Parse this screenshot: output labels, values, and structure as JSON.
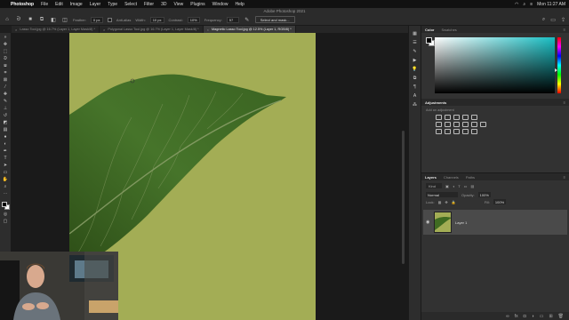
{
  "menubar": {
    "apple": "",
    "app_name": "Photoshop",
    "items": [
      "File",
      "Edit",
      "Image",
      "Layer",
      "Type",
      "Select",
      "Filter",
      "3D",
      "View",
      "Plugins",
      "Window",
      "Help"
    ],
    "clock": "Mon 11:27 AM"
  },
  "options": {
    "app_title": "Adobe Photoshop 2021",
    "feather_label": "Feather:",
    "feather_value": "0 px",
    "antialias_label": "Anti-alias",
    "width_label": "Width:",
    "width_value": "10 px",
    "contrast_label": "Contrast:",
    "contrast_value": "10%",
    "frequency_label": "Frequency:",
    "frequency_value": "57",
    "select_mask_label": "Select and mask..."
  },
  "tabs": [
    {
      "label": "Lasso Tool.jpg @ 16.7% (Layer 1, Layer Mask/8) *",
      "active": false
    },
    {
      "label": "Polygonal Lasso Tool.jpg @ 16.7% (Layer 1, Layer Mask/8) *",
      "active": false
    },
    {
      "label": "Magnetic Lasso Tool.jpg @ 12.5% (Layer 1, RGB/8) *",
      "active": true
    }
  ],
  "color_panel": {
    "tabs": [
      "Color",
      "Swatches"
    ],
    "active_tab": "Color",
    "hue_color": "#18bfc4"
  },
  "adjustments": {
    "title": "Adjustments",
    "add_label": "Add an adjustment"
  },
  "layers": {
    "tabs": [
      "Layers",
      "Channels",
      "Paths"
    ],
    "active_tab": "Layers",
    "kind_label": "Kind",
    "blend_mode": "Normal",
    "opacity_label": "Opacity:",
    "opacity_value": "100%",
    "lock_label": "Lock:",
    "fill_label": "Fill:",
    "fill_value": "100%",
    "layer_name": "Layer 1"
  },
  "colors": {
    "canvas_bg": "#a3ad55",
    "leaf": "#3f6b21"
  }
}
